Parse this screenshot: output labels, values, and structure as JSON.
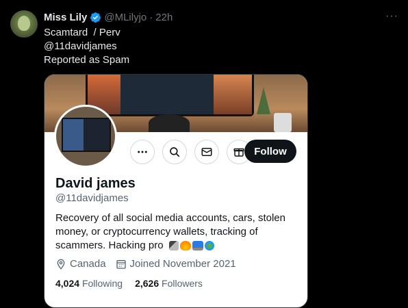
{
  "tweet": {
    "author_name": "Miss Lily",
    "author_handle": "@MLilyjo",
    "separator": "·",
    "time": "22h",
    "more_label": "···",
    "text": "Scamtard  / Perv\n@11davidjames\nReported as Spam"
  },
  "profile_card": {
    "display_name": "David james",
    "handle": "@11davidjames",
    "bio": "Recovery of all social media accounts, cars, stolen money, or cryptocurrency wallets, tracking of scammers. Hacking pro",
    "bio_emojis": [
      "plug",
      "fire",
      "laptop",
      "globe"
    ],
    "location": "Canada",
    "joined": "Joined November 2021",
    "following_count": "4,024",
    "following_label": "Following",
    "followers_count": "2,626",
    "followers_label": "Followers",
    "follow_button": "Follow",
    "action_icons": [
      "more-icon",
      "search-icon",
      "mail-icon",
      "subscribe-icon"
    ]
  },
  "colors": {
    "verified": "#1d9bf0",
    "follow_button_bg": "#0f1419",
    "secondary_text": "#536471",
    "muted": "#71767b"
  }
}
